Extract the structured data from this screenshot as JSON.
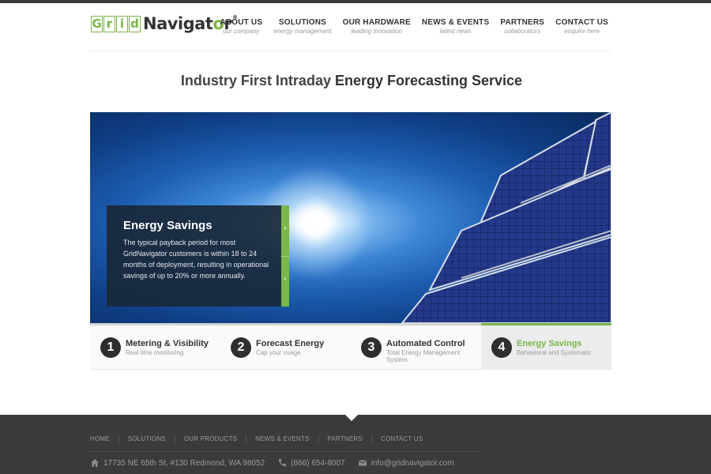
{
  "logo": {
    "grid_letters": [
      "G",
      "r",
      "i",
      "d"
    ],
    "text": "Navigat",
    "o": "o",
    "r": "r",
    "reg": "®"
  },
  "nav": [
    {
      "title": "ABOUT US",
      "sub": "our company"
    },
    {
      "title": "SOLUTIONS",
      "sub": "energy management"
    },
    {
      "title": "OUR HARDWARE",
      "sub": "leading innovation"
    },
    {
      "title": "NEWS & EVENTS",
      "sub": "latest news"
    },
    {
      "title": "PARTNERS",
      "sub": "collaborators"
    },
    {
      "title": "CONTACT US",
      "sub": "enquire here"
    }
  ],
  "headline": {
    "light": "Industry First Intraday ",
    "bold": "Energy Forecasting Service"
  },
  "hero": {
    "title": "Energy Savings",
    "text": "The typical payback period for most GridNavigator customers is within 18 to 24 months of deployment, resulting in operational savings of up to 20% or more annually.",
    "next_icon": "›",
    "prev_icon": "‹"
  },
  "steps": [
    {
      "num": "1",
      "title": "Metering & Visibility",
      "sub": "Real time monitoring",
      "active": false
    },
    {
      "num": "2",
      "title": "Forecast Energy",
      "sub": "Cap your usage",
      "active": false
    },
    {
      "num": "3",
      "title": "Automated Control",
      "sub": "Total Energy Management System",
      "active": false
    },
    {
      "num": "4",
      "title": "Energy Savings",
      "sub": "Behavioral and Systematic",
      "active": true
    }
  ],
  "footer": {
    "links": [
      "HOME",
      "SOLUTIONS",
      "OUR PRODUCTS",
      "NEWS & EVENTS",
      "PARTNERS",
      "CONTACT US"
    ],
    "address": "17735 NE 65th St, #130 Redmond, WA 98052",
    "phone": "(866) 654-8007",
    "email": "info@gridnavigator.com"
  },
  "colors": {
    "accent": "#7ab648",
    "dark": "#3b3b3b",
    "info_box": "#19283a"
  }
}
